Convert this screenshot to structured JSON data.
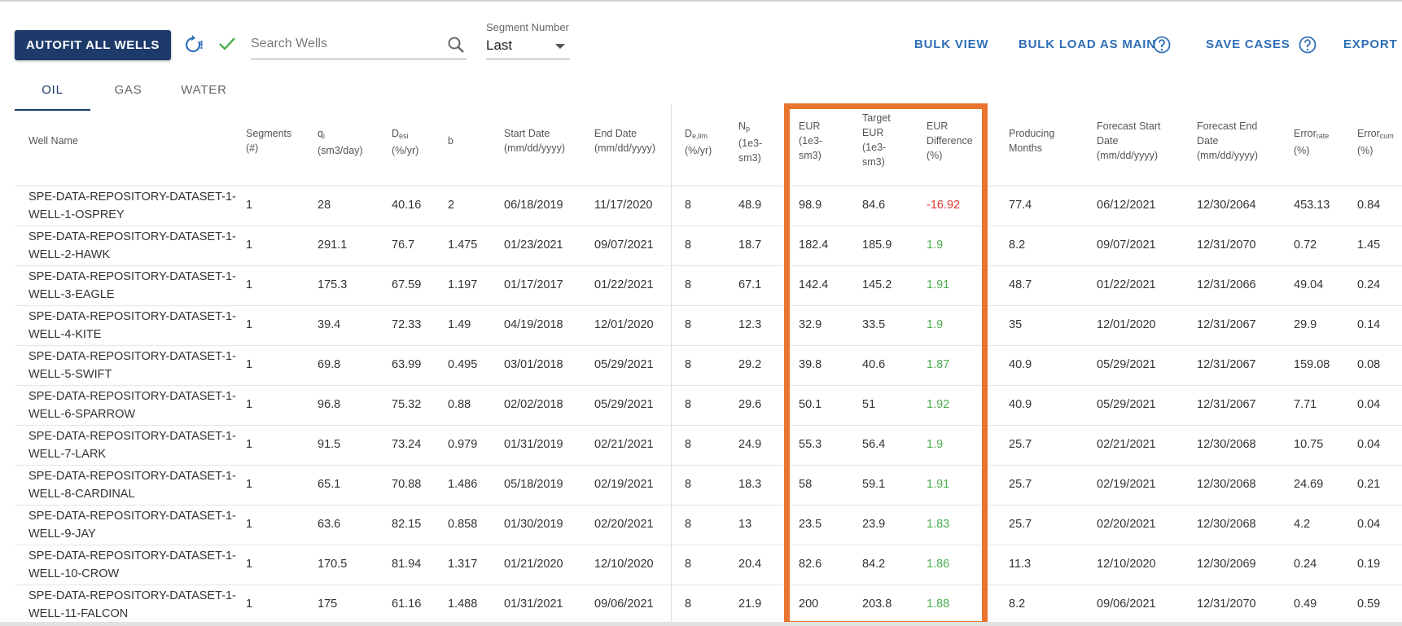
{
  "toolbar": {
    "autofit_label": "AUTOFIT ALL WELLS",
    "refresh_badge": "!",
    "search_placeholder": "Search Wells",
    "segment_label": "Segment Number",
    "segment_value": "Last",
    "bulk_view": "BULK VIEW",
    "bulk_load": "BULK LOAD AS MAIN",
    "save_cases": "SAVE CASES",
    "export": "EXPORT"
  },
  "tabs": [
    "OIL",
    "GAS",
    "WATER"
  ],
  "columns": {
    "well_name": "Well Name",
    "segments": [
      "Segments",
      "(#)"
    ],
    "qi": [
      "q",
      "i",
      "(sm3/day)"
    ],
    "desi": [
      "D",
      "esi",
      "(%/yr)"
    ],
    "b": "b",
    "start_date": [
      "Start Date",
      "(mm/dd/yyyy)"
    ],
    "end_date": [
      "End Date",
      "(mm/dd/yyyy)"
    ],
    "delim": [
      "D",
      "e,lim",
      "(%/yr)"
    ],
    "np": [
      "N",
      "p",
      "(1e3-",
      "sm3)"
    ],
    "eur": [
      "EUR",
      "(1e3-",
      "sm3)"
    ],
    "target_eur": [
      "Target",
      "EUR",
      "(1e3-",
      "sm3)"
    ],
    "eur_diff": [
      "EUR",
      "Difference",
      "(%)"
    ],
    "producing_months": [
      "Producing",
      "Months"
    ],
    "forecast_start": [
      "Forecast Start",
      "Date",
      "(mm/dd/yyyy)"
    ],
    "forecast_end": [
      "Forecast End",
      "Date",
      "(mm/dd/yyyy)"
    ],
    "error_rate": [
      "Error",
      "rate",
      "(%)"
    ],
    "error_cum": [
      "Error",
      "cum",
      "(%)"
    ]
  },
  "rows": [
    {
      "name1": "SPE-DATA-REPOSITORY-DATASET-1-",
      "name2": "WELL-1-OSPREY",
      "segments": "1",
      "qi": "28",
      "desi": "40.16",
      "b": "2",
      "start": "06/18/2019",
      "end": "11/17/2020",
      "delim": "8",
      "np": "48.9",
      "eur": "98.9",
      "target": "84.6",
      "diff": "-16.92",
      "months": "77.4",
      "fstart": "06/12/2021",
      "fend": "12/30/2064",
      "err_rate": "453.13",
      "err_cum": "0.84"
    },
    {
      "name1": "SPE-DATA-REPOSITORY-DATASET-1-",
      "name2": "WELL-2-HAWK",
      "segments": "1",
      "qi": "291.1",
      "desi": "76.7",
      "b": "1.475",
      "start": "01/23/2021",
      "end": "09/07/2021",
      "delim": "8",
      "np": "18.7",
      "eur": "182.4",
      "target": "185.9",
      "diff": "1.9",
      "months": "8.2",
      "fstart": "09/07/2021",
      "fend": "12/31/2070",
      "err_rate": "0.72",
      "err_cum": "1.45"
    },
    {
      "name1": "SPE-DATA-REPOSITORY-DATASET-1-",
      "name2": "WELL-3-EAGLE",
      "segments": "1",
      "qi": "175.3",
      "desi": "67.59",
      "b": "1.197",
      "start": "01/17/2017",
      "end": "01/22/2021",
      "delim": "8",
      "np": "67.1",
      "eur": "142.4",
      "target": "145.2",
      "diff": "1.91",
      "months": "48.7",
      "fstart": "01/22/2021",
      "fend": "12/31/2066",
      "err_rate": "49.04",
      "err_cum": "0.24"
    },
    {
      "name1": "SPE-DATA-REPOSITORY-DATASET-1-",
      "name2": "WELL-4-KITE",
      "segments": "1",
      "qi": "39.4",
      "desi": "72.33",
      "b": "1.49",
      "start": "04/19/2018",
      "end": "12/01/2020",
      "delim": "8",
      "np": "12.3",
      "eur": "32.9",
      "target": "33.5",
      "diff": "1.9",
      "months": "35",
      "fstart": "12/01/2020",
      "fend": "12/31/2067",
      "err_rate": "29.9",
      "err_cum": "0.14"
    },
    {
      "name1": "SPE-DATA-REPOSITORY-DATASET-1-",
      "name2": "WELL-5-SWIFT",
      "segments": "1",
      "qi": "69.8",
      "desi": "63.99",
      "b": "0.495",
      "start": "03/01/2018",
      "end": "05/29/2021",
      "delim": "8",
      "np": "29.2",
      "eur": "39.8",
      "target": "40.6",
      "diff": "1.87",
      "months": "40.9",
      "fstart": "05/29/2021",
      "fend": "12/31/2067",
      "err_rate": "159.08",
      "err_cum": "0.08"
    },
    {
      "name1": "SPE-DATA-REPOSITORY-DATASET-1-",
      "name2": "WELL-6-SPARROW",
      "segments": "1",
      "qi": "96.8",
      "desi": "75.32",
      "b": "0.88",
      "start": "02/02/2018",
      "end": "05/29/2021",
      "delim": "8",
      "np": "29.6",
      "eur": "50.1",
      "target": "51",
      "diff": "1.92",
      "months": "40.9",
      "fstart": "05/29/2021",
      "fend": "12/31/2067",
      "err_rate": "7.71",
      "err_cum": "0.04"
    },
    {
      "name1": "SPE-DATA-REPOSITORY-DATASET-1-",
      "name2": "WELL-7-LARK",
      "segments": "1",
      "qi": "91.5",
      "desi": "73.24",
      "b": "0.979",
      "start": "01/31/2019",
      "end": "02/21/2021",
      "delim": "8",
      "np": "24.9",
      "eur": "55.3",
      "target": "56.4",
      "diff": "1.9",
      "months": "25.7",
      "fstart": "02/21/2021",
      "fend": "12/30/2068",
      "err_rate": "10.75",
      "err_cum": "0.04"
    },
    {
      "name1": "SPE-DATA-REPOSITORY-DATASET-1-",
      "name2": "WELL-8-CARDINAL",
      "segments": "1",
      "qi": "65.1",
      "desi": "70.88",
      "b": "1.486",
      "start": "05/18/2019",
      "end": "02/19/2021",
      "delim": "8",
      "np": "18.3",
      "eur": "58",
      "target": "59.1",
      "diff": "1.91",
      "months": "25.7",
      "fstart": "02/19/2021",
      "fend": "12/30/2068",
      "err_rate": "24.69",
      "err_cum": "0.21"
    },
    {
      "name1": "SPE-DATA-REPOSITORY-DATASET-1-",
      "name2": "WELL-9-JAY",
      "segments": "1",
      "qi": "63.6",
      "desi": "82.15",
      "b": "0.858",
      "start": "01/30/2019",
      "end": "02/20/2021",
      "delim": "8",
      "np": "13",
      "eur": "23.5",
      "target": "23.9",
      "diff": "1.83",
      "months": "25.7",
      "fstart": "02/20/2021",
      "fend": "12/30/2068",
      "err_rate": "4.2",
      "err_cum": "0.04"
    },
    {
      "name1": "SPE-DATA-REPOSITORY-DATASET-1-",
      "name2": "WELL-10-CROW",
      "segments": "1",
      "qi": "170.5",
      "desi": "81.94",
      "b": "1.317",
      "start": "01/21/2020",
      "end": "12/10/2020",
      "delim": "8",
      "np": "20.4",
      "eur": "82.6",
      "target": "84.2",
      "diff": "1.86",
      "months": "11.3",
      "fstart": "12/10/2020",
      "fend": "12/30/2069",
      "err_rate": "0.24",
      "err_cum": "0.19"
    },
    {
      "name1": "SPE-DATA-REPOSITORY-DATASET-1-",
      "name2": "WELL-11-FALCON",
      "segments": "1",
      "qi": "175",
      "desi": "61.16",
      "b": "1.488",
      "start": "01/31/2021",
      "end": "09/06/2021",
      "delim": "8",
      "np": "21.9",
      "eur": "200",
      "target": "203.8",
      "diff": "1.88",
      "months": "8.2",
      "fstart": "09/06/2021",
      "fend": "12/31/2070",
      "err_rate": "0.49",
      "err_cum": "0.59"
    }
  ],
  "colors": {
    "primary": "#1d3a6b",
    "link": "#2f6fb7",
    "negative": "#e23b2e",
    "positive": "#4caf50",
    "highlight": "#e8742f"
  }
}
